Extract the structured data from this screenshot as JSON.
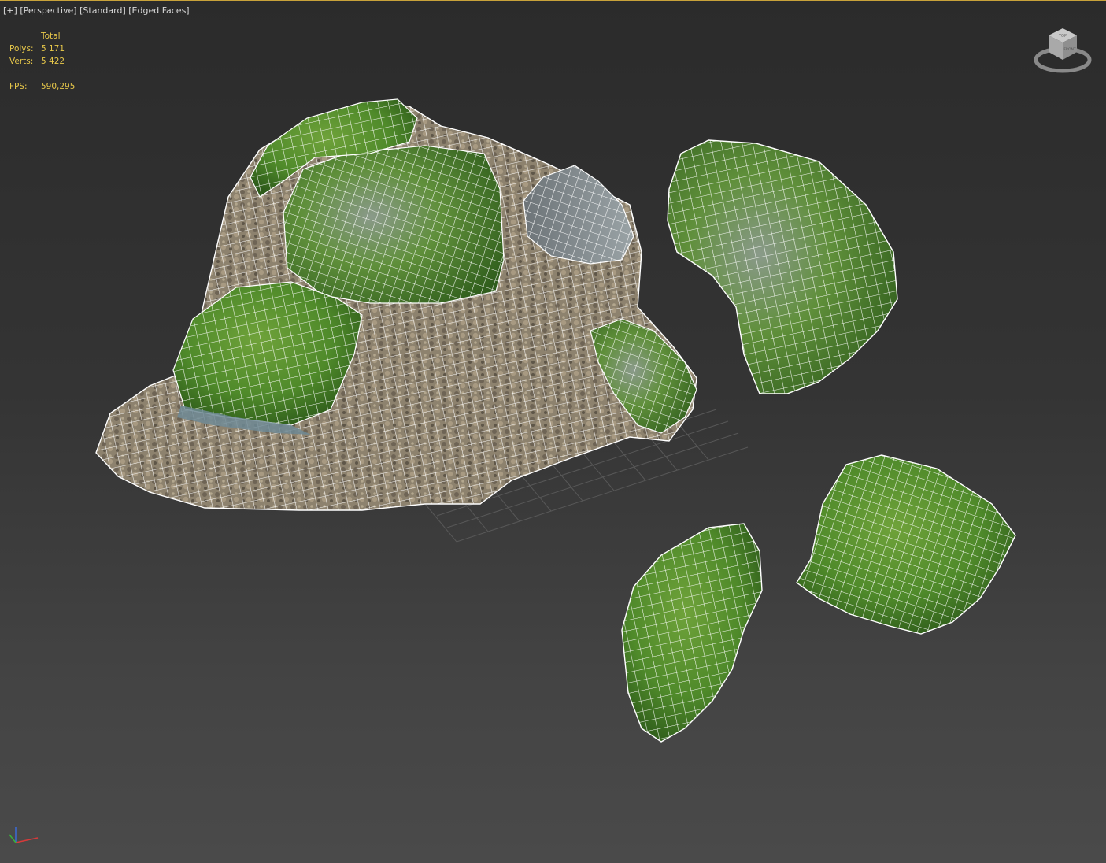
{
  "viewport": {
    "plus": "[+]",
    "view": "[Perspective]",
    "shading": "[Standard]",
    "mode": "[Edged Faces]"
  },
  "stats": {
    "header": "Total",
    "polys_label": "Polys:",
    "polys_value": "5 171",
    "verts_label": "Verts:",
    "verts_value": "5 422",
    "fps_label": "FPS:",
    "fps_value": "590,295"
  },
  "navcube": {
    "icon": "viewcube-icon",
    "face_top": "TOP",
    "face_front": "FRONT"
  },
  "axis_tripod": {
    "icon": "axis-tripod-icon"
  },
  "colors": {
    "stats_text": "#e8c84a",
    "label_text": "#d8d8d8",
    "wire": "#ffffff",
    "moss": "#4f8a2a",
    "stone": "#8a7f6c"
  }
}
